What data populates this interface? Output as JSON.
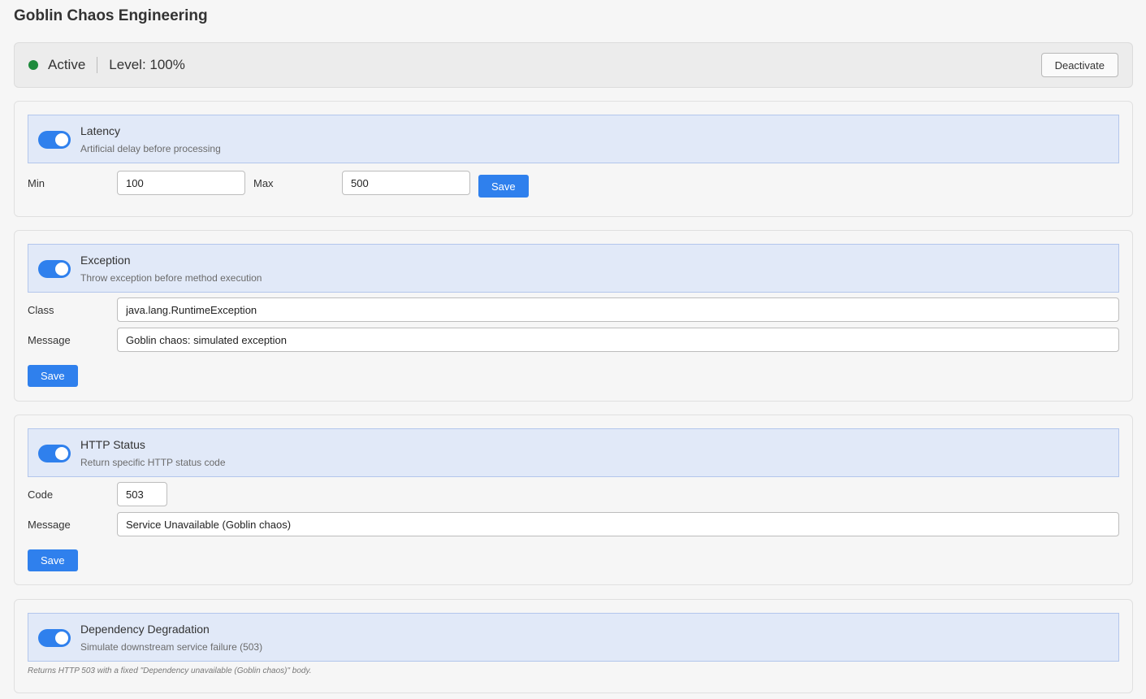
{
  "page_title": "Goblin Chaos Engineering",
  "status": {
    "state_label": "Active",
    "level_label": "Level: 100%",
    "indicator_color": "#1e8a3c",
    "deactivate_label": "Deactivate"
  },
  "latency": {
    "enabled": true,
    "title": "Latency",
    "description": "Artificial delay before processing",
    "min_label": "Min",
    "min_value": "100",
    "max_label": "Max",
    "max_value": "500",
    "save_label": "Save"
  },
  "exception": {
    "enabled": true,
    "title": "Exception",
    "description": "Throw exception before method execution",
    "class_label": "Class",
    "class_value": "java.lang.RuntimeException",
    "message_label": "Message",
    "message_value": "Goblin chaos: simulated exception",
    "save_label": "Save"
  },
  "http_status": {
    "enabled": true,
    "title": "HTTP Status",
    "description": "Return specific HTTP status code",
    "code_label": "Code",
    "code_value": "503",
    "message_label": "Message",
    "message_value": "Service Unavailable (Goblin chaos)",
    "save_label": "Save"
  },
  "dependency": {
    "enabled": true,
    "title": "Dependency Degradation",
    "description": "Simulate downstream service failure (503)",
    "note": "Returns HTTP 503 with a fixed \"Dependency unavailable (Goblin chaos)\" body."
  },
  "colors": {
    "accent": "#2f80ed",
    "header_bg": "#e1e9f8",
    "active": "#1e8a3c"
  }
}
